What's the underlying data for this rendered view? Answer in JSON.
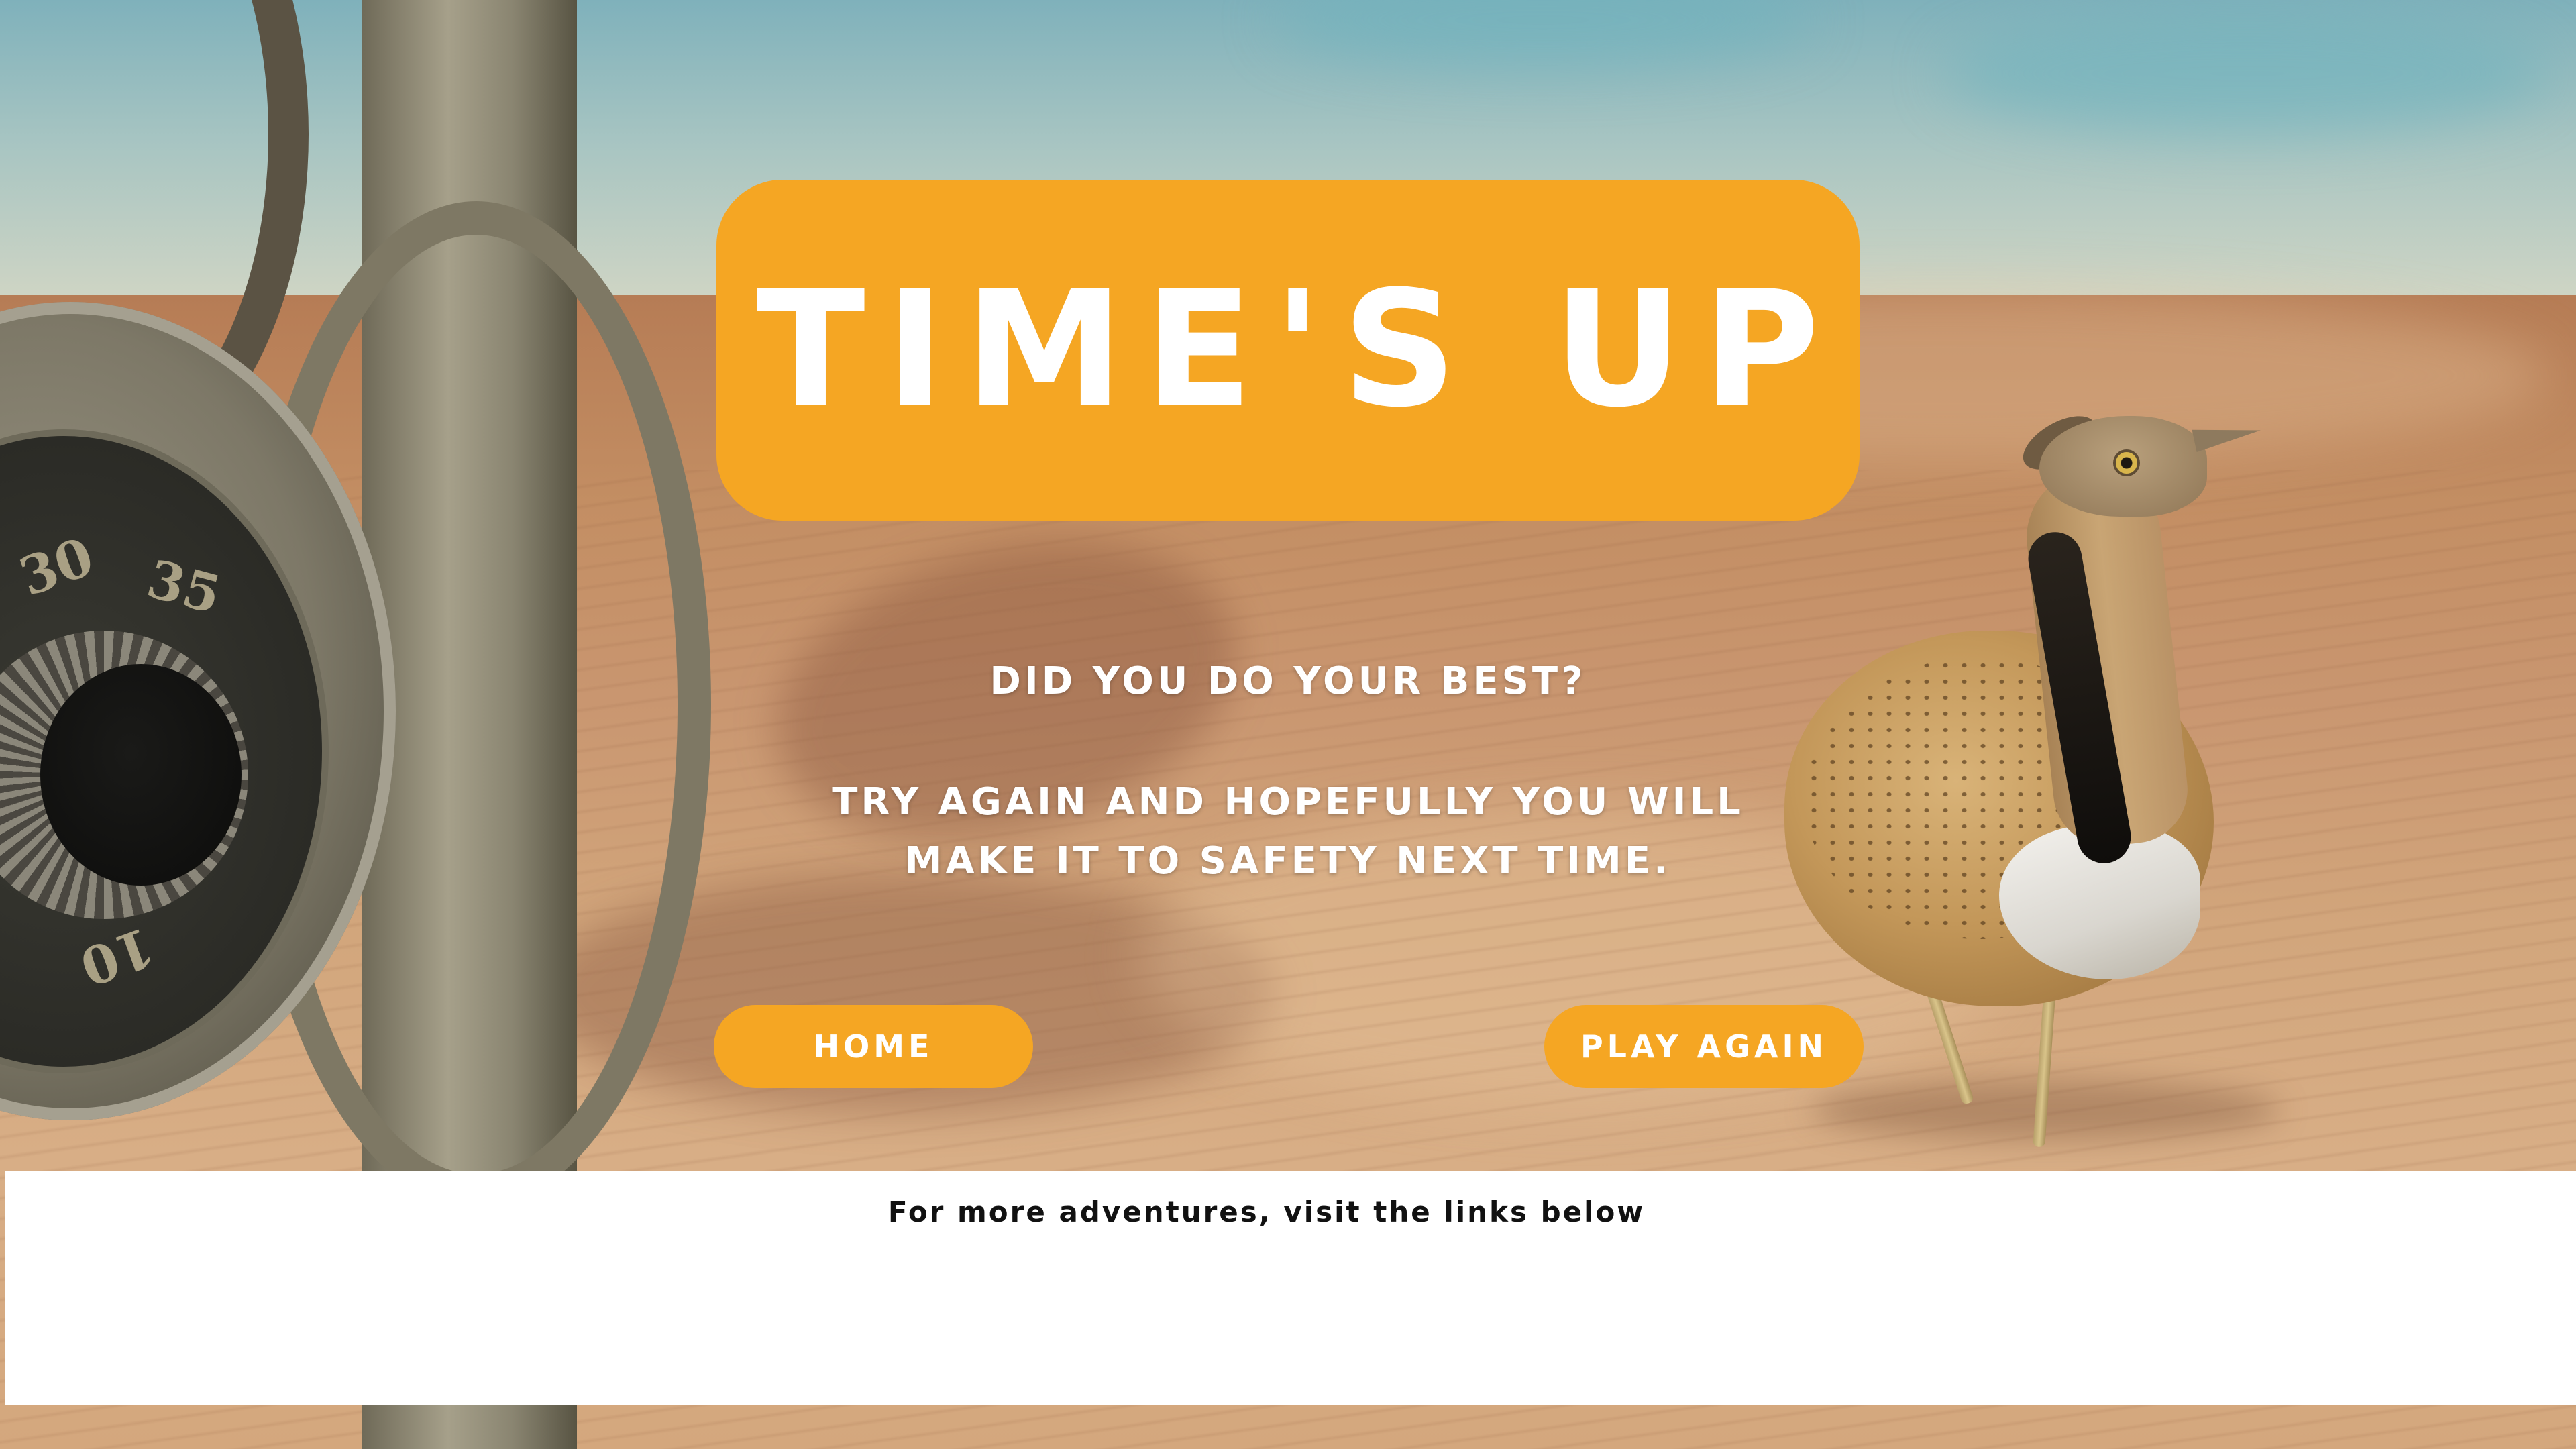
{
  "screen": {
    "title": "TIME'S UP",
    "message_line_1": "DID YOU DO YOUR BEST?",
    "message_line_2": "TRY AGAIN AND HOPEFULLY YOU WILL",
    "message_line_3": "MAKE IT TO SAFETY NEXT TIME."
  },
  "buttons": {
    "home_label": "HOME",
    "play_again_label": "PLAY AGAIN"
  },
  "footer": {
    "text": "For more adventures, visit the links below"
  },
  "background": {
    "dial_numbers": [
      "30",
      "35",
      "10"
    ]
  },
  "colors": {
    "accent": "#f5a623",
    "text_on_accent": "#ffffff",
    "footer_bg": "#ffffff",
    "footer_text": "#111111"
  }
}
